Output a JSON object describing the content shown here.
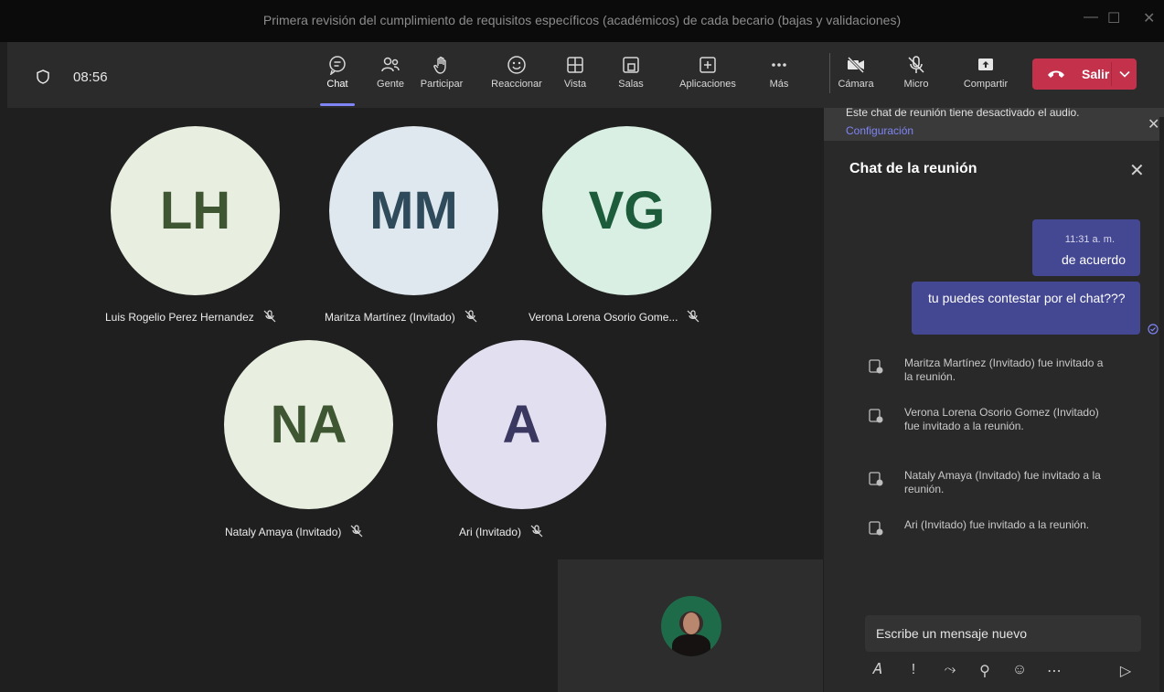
{
  "window": {
    "title": "Primera revisión del cumplimiento de requisitos específicos (académicos) de cada becario (bajas y validaciones)"
  },
  "toolbar": {
    "timer": "08:56",
    "tools": [
      {
        "label": "Chat",
        "icon": "chat-icon",
        "active": true
      },
      {
        "label": "Gente",
        "icon": "people-icon"
      },
      {
        "label": "Participar",
        "icon": "raise-hand-icon"
      },
      {
        "label": "Reaccionar",
        "icon": "smile-icon"
      },
      {
        "label": "Vista",
        "icon": "grid-view-icon"
      },
      {
        "label": "Salas",
        "icon": "breakout-rooms-icon"
      },
      {
        "label": "Aplicaciones",
        "icon": "add-app-icon"
      },
      {
        "label": "Más",
        "icon": "more-icon"
      },
      {
        "label": "Cámara",
        "icon": "camera-off-icon"
      },
      {
        "label": "Micro",
        "icon": "mic-off-icon"
      },
      {
        "label": "Compartir",
        "icon": "share-icon"
      }
    ],
    "leave_label": "Salir",
    "leave_color": "#c4314b",
    "accent_color": "#7f85f5"
  },
  "participants": [
    {
      "initials": "LH",
      "name": "Luis Rogelio Perez Hernandez",
      "bg": "#e8efe0",
      "fg": "#3f5632"
    },
    {
      "initials": "MM",
      "name": "Maritza Martínez (Invitado)",
      "bg": "#dfe8ef",
      "fg": "#2f4a5a"
    },
    {
      "initials": "VG",
      "name": "Verona Lorena Osorio Gome...",
      "bg": "#d9efe3",
      "fg": "#1d5c3b"
    },
    {
      "initials": "NA",
      "name": "Nataly Amaya (Invitado)",
      "bg": "#e8efe0",
      "fg": "#3f5632"
    },
    {
      "initials": "A",
      "name": "Ari (Invitado)",
      "bg": "#e2e0f0",
      "fg": "#3a3760"
    }
  ],
  "chat": {
    "banner_text": "Este chat de reunión tiene desactivado el audio.",
    "banner_link": "Configuración",
    "title": "Chat de la reunión",
    "messages": [
      {
        "time": "11:31 a. m.",
        "text": "de acuerdo"
      },
      {
        "text": "tu puedes contestar por el chat???"
      }
    ],
    "events": [
      "Maritza Martínez (Invitado) fue invitado a la reunión.",
      "Verona Lorena Osorio Gomez (Invitado) fue invitado a la reunión.",
      "Nataly Amaya (Invitado) fue invitado a la reunión.",
      "Ari (Invitado) fue invitado a la reunión."
    ],
    "composer_placeholder": "Escribe un mensaje nuevo"
  }
}
